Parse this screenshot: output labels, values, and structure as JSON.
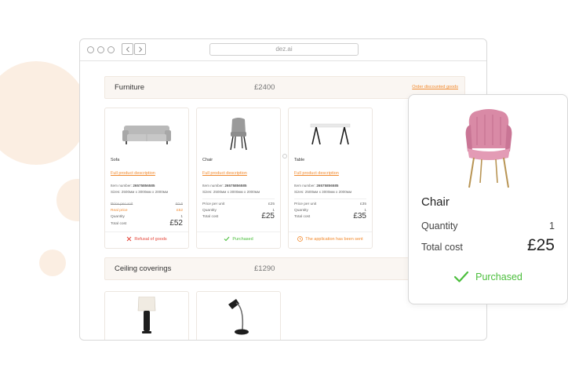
{
  "colors": {
    "accent": "#f28a2e",
    "success": "#4bbe3c",
    "danger": "#e5483c",
    "blob": "#fbeee2"
  },
  "browser": {
    "url": "dez.ai",
    "back_icon": "chevron-left",
    "forward_icon": "chevron-right"
  },
  "furniture": {
    "title": "Furniture",
    "price": "£2400",
    "link": "Order discounted goods",
    "items": [
      {
        "name": "Sofa",
        "icon": "sofa-image",
        "desc_link": "Full product description",
        "item_number_label": "Item number:",
        "item_number": "26575856585",
        "sizes_label": "Sizes:",
        "sizes": "2500мм х 3000мм х 2000мм",
        "price_per_unit_label": "Price per unit",
        "price_per_unit": "£0 6",
        "real_price_label": "Real price",
        "real_price": "£52",
        "quantity_label": "Quantity",
        "quantity": "1",
        "total_cost_label": "Total cost",
        "total_cost": "£52",
        "status": "Refusal of goods",
        "status_icon": "close-icon"
      },
      {
        "name": "Chair",
        "icon": "chair-image",
        "desc_link": "Full product description",
        "item_number_label": "Item number:",
        "item_number": "26575856585",
        "sizes_label": "Sizes:",
        "sizes": "2500мм х 3000мм х 2000мм",
        "price_per_unit_label": "Price per unit",
        "price_per_unit": "£25",
        "quantity_label": "Quantity",
        "quantity": "1",
        "total_cost_label": "Total cost",
        "total_cost": "£25",
        "status": "Purchased",
        "status_icon": "check-icon"
      },
      {
        "name": "Table",
        "icon": "table-image",
        "desc_link": "Full product description",
        "item_number_label": "Item number:",
        "item_number": "26575856585",
        "sizes_label": "Sizes:",
        "sizes": "2500мм х 3000мм х 2000мм",
        "price_per_unit_label": "Price per unit",
        "price_per_unit": "£35",
        "quantity_label": "Quantity",
        "quantity": "1",
        "total_cost_label": "Total cost",
        "total_cost": "£35",
        "status": "The application has been sent",
        "status_icon": "clock-icon"
      }
    ]
  },
  "ceiling": {
    "title": "Ceiling coverings",
    "price": "£1290",
    "items": [
      {
        "icon": "table-lamp-image"
      },
      {
        "icon": "desk-lamp-image"
      }
    ]
  },
  "popup": {
    "name": "Chair",
    "quantity_label": "Quantity",
    "quantity": "1",
    "total_cost_label": "Total cost",
    "total_cost": "£25",
    "status": "Purchased",
    "status_icon": "check-icon"
  }
}
